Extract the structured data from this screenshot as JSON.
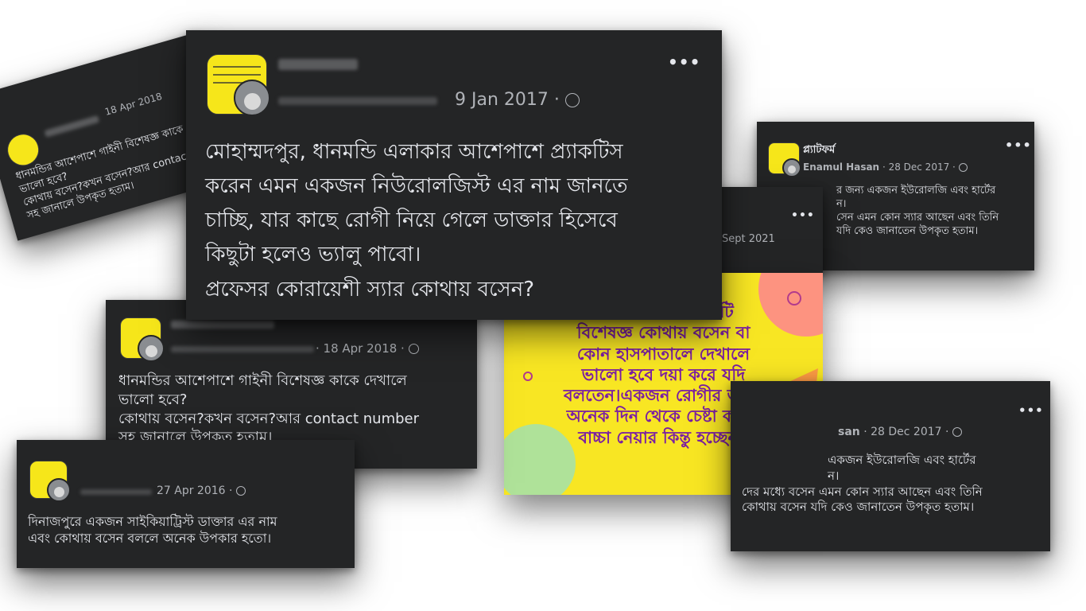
{
  "main_post": {
    "date": "9 Jan 2017 ·",
    "body_lines": [
      "মোহাম্মদপুর, ধানমন্ডি এলাকার আশেপাশে প্র্যাকটিস",
      "করেন এমন একজন নিউরোলজিস্ট এর নাম জানতে",
      "চাচ্ছি, যার কাছে রোগী নিয়ে গেলে ডাক্তার হিসেবে",
      "কিছুটা হলেও ভ্যালু পাবো।",
      "প্রফেসর কোরায়েশী স্যার কোথায় বসেন?"
    ],
    "menu_icon": "more-dots-icon"
  },
  "tilted_post": {
    "date": "18 Apr 2018",
    "body_lines": [
      "ধানমন্ডির আশেপাশে গাইনী বিশেষজ্ঞ কাকে",
      "ভালো হবে?",
      "কোথায় বসেন?কখন বসেন?আর contact",
      "সহ জানালে উপকৃত হতাম।"
    ]
  },
  "gyne_post": {
    "date": "· 18 Apr 2018 ·",
    "body_lines": [
      "ধানমন্ডির আশেপাশে গাইনী বিশেষজ্ঞ কাকে দেখালে",
      "ভালো হবে?",
      "কোথায় বসেন?কখন বসেন?আর contact number",
      "সহ জানালে উপকৃত হতাম।"
    ]
  },
  "dinajpur_post": {
    "date": "27 Apr 2016 ·",
    "body_lines": [
      "দিনাজপুরে একজন সাইকিয়াট্রিস্ট ডাক্তার এর নাম",
      "এবং  কোথায় বসেন বললে অনেক উপকার হতো।"
    ]
  },
  "uro_post_top": {
    "group_name": "প্ল্যাটফর্ম",
    "author": "Enamul Hasan",
    "date": "· 28 Dec 2017 ·",
    "body_lines": [
      "র জন্য একজন ইউরোলজি এবং হার্টের",
      "ন।",
      "সেন এমন কোন স্যার আছেন এবং তিনি",
      "যদি কেও জানাতেন উপকৃত হতাম।"
    ]
  },
  "sept_post": {
    "date": "Sept 2021",
    "poster_lines": [
      "টিলিটি",
      "বিশেষজ্ঞ কোথায় বসেন বা",
      "কোন হাসপাতালে দেখালে",
      "ভালো হবে দয়া করে যদি",
      "বলতেন।একজন রোগীর জন্য,",
      "অনেক দিন থেকে চেষ্টা করছে",
      "বাচ্চা নেয়ার কিন্তু হচ্ছেনা।"
    ]
  },
  "uro_post_bottom": {
    "author_fragment": "san",
    "date": "· 28 Dec 2017 ·",
    "body_lines": [
      "একজন ইউরোলজি এবং হার্টের",
      "ন।",
      "দের মধ্যে বসেন এমন কোন স্যার আছেন এবং তিনি",
      "কোথায় বসেন যদি কেও জানাতেন উপকৃত হতাম।"
    ]
  },
  "colors": {
    "card_bg": "#242526",
    "text_primary": "#e4e6eb",
    "text_secondary": "#b0b3b8",
    "poster_bg": "#f8e623",
    "poster_text": "#7b1fa2"
  }
}
